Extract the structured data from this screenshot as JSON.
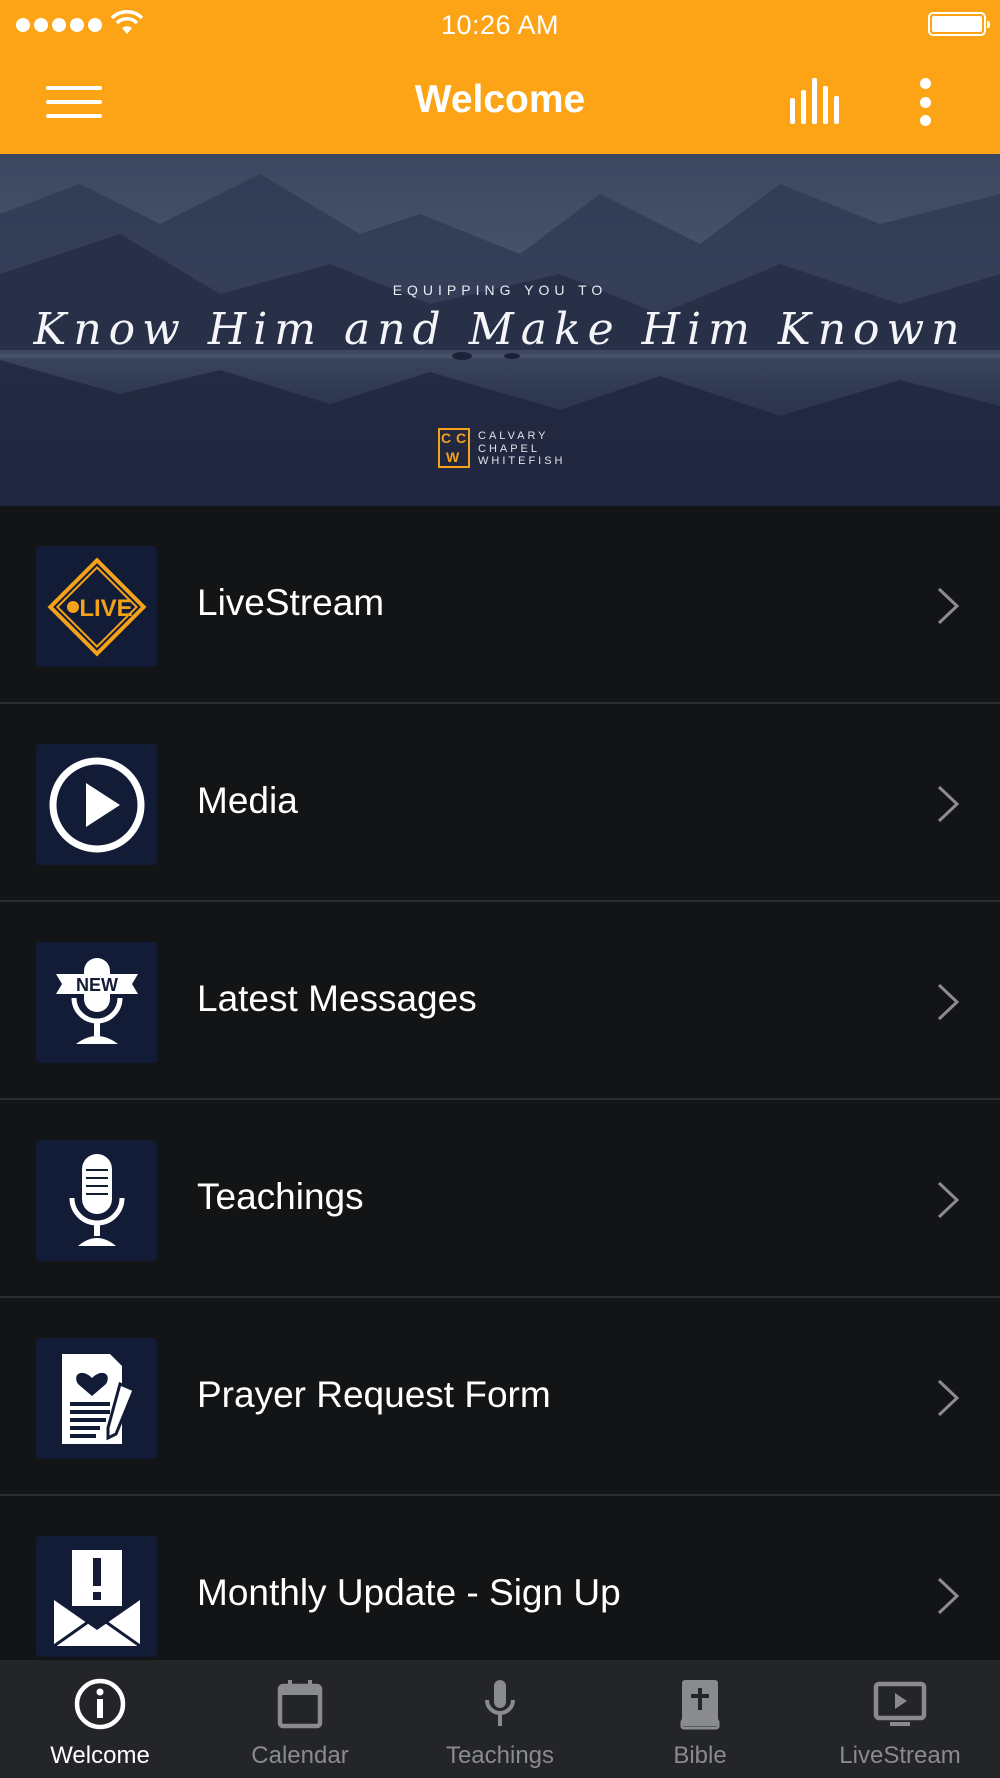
{
  "status_bar": {
    "time": "10:26 AM"
  },
  "header": {
    "title": "Welcome"
  },
  "banner": {
    "tagline_small": "EQUIPPING YOU TO",
    "tagline_big": "Know Him and Make Him Known",
    "church_name_lines": [
      "CALVARY",
      "CHAPEL",
      "WHITEFISH"
    ],
    "logo_letters": [
      "C",
      "C",
      "W"
    ]
  },
  "menu_items": [
    {
      "label": "LiveStream",
      "icon": "live-icon"
    },
    {
      "label": "Media",
      "icon": "play-icon"
    },
    {
      "label": "Latest Messages",
      "icon": "new-microphone-icon"
    },
    {
      "label": "Teachings",
      "icon": "microphone-icon"
    },
    {
      "label": "Prayer Request Form",
      "icon": "prayer-form-icon"
    },
    {
      "label": "Monthly Update - Sign Up",
      "icon": "envelope-alert-icon"
    }
  ],
  "live_badge_text": "LIVE",
  "new_badge_text": "NEW",
  "tabs": [
    {
      "label": "Welcome",
      "icon": "info-icon",
      "active": true
    },
    {
      "label": "Calendar",
      "icon": "calendar-icon",
      "active": false
    },
    {
      "label": "Teachings",
      "icon": "microphone-icon",
      "active": false
    },
    {
      "label": "Bible",
      "icon": "bible-icon",
      "active": false
    },
    {
      "label": "LiveStream",
      "icon": "tv-play-icon",
      "active": false
    }
  ],
  "colors": {
    "accent": "#fca415",
    "background": "#131416",
    "thumb_bg": "#131c36",
    "tabbar": "#242528"
  }
}
